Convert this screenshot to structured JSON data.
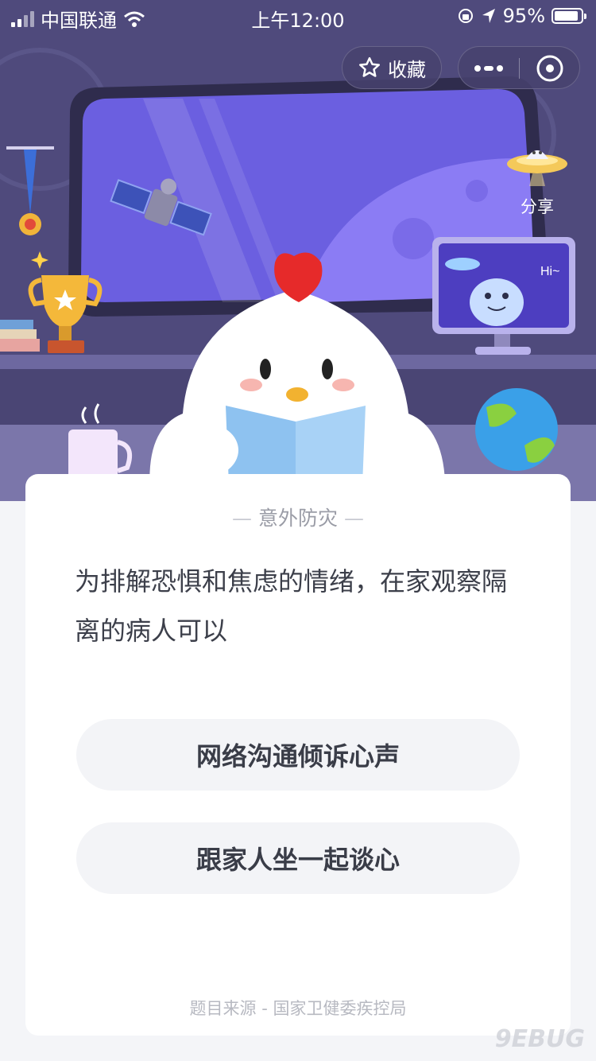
{
  "status_bar": {
    "carrier": "中国联通",
    "time": "上午12:00",
    "battery": "95%"
  },
  "top_actions": {
    "favorite_label": "收藏",
    "share_label": "分享"
  },
  "scene": {
    "monitor_greeting": "Hi~"
  },
  "quiz": {
    "category": "意外防灾",
    "question": "为排解恐惧和焦虑的情绪，在家观察隔离的病人可以",
    "options": [
      {
        "label": "网络沟通倾诉心声"
      },
      {
        "label": "跟家人坐一起谈心"
      }
    ],
    "source": "题目来源 - 国家卫健委疾控局"
  },
  "watermark": "9EBUG",
  "colors": {
    "scene_bg": "#4f4a7c",
    "window_glass": "#6b5fe0",
    "card_bg": "#ffffff",
    "option_bg": "#f3f4f7",
    "chicken_comb": "#e62a2a"
  }
}
